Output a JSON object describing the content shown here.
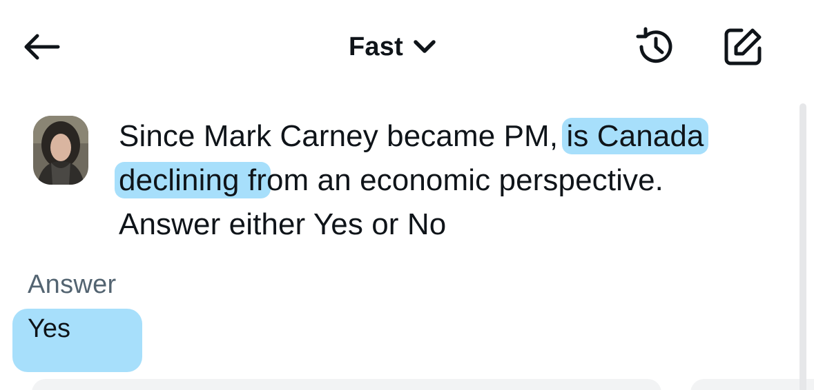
{
  "header": {
    "mode_label": "Fast",
    "icons": {
      "back": "arrow-left-icon",
      "mode_dropdown": "chevron-down-icon",
      "history": "history-icon",
      "new_chat": "compose-icon"
    }
  },
  "message": {
    "prompt_segments": {
      "line1_plain": "Since Mark Carney became PM,",
      "line1_highlight": "is Canada",
      "line2_highlight": "declining fr",
      "line2_plain": "om an economic perspective.",
      "line3": "Answer either Yes or No"
    },
    "highlight_color": "#82d2fa"
  },
  "answer": {
    "heading": "Answer",
    "value": "Yes"
  },
  "colors": {
    "text": "#0f1419",
    "muted": "#536471",
    "background": "#ffffff"
  }
}
